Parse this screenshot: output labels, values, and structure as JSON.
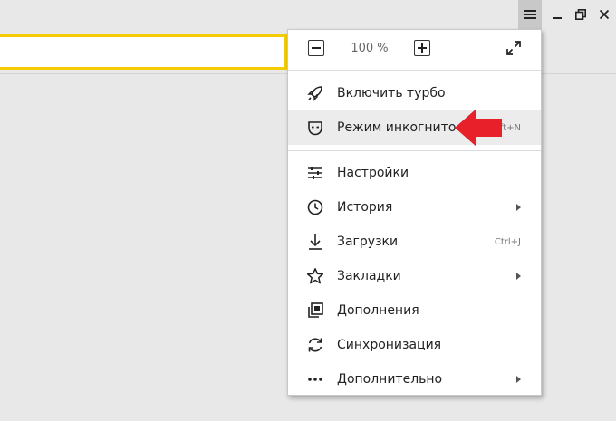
{
  "zoom": {
    "value": "100 %"
  },
  "menu": {
    "items": [
      {
        "label": "Включить турбо",
        "icon": "rocket-icon"
      },
      {
        "label": "Режим инкогнито",
        "icon": "incognito-mask-icon",
        "shortcut": "Ctrl+Shift+N",
        "shortcut_visible": "ft+N"
      },
      {
        "label": "Настройки",
        "icon": "settings-sliders-icon"
      },
      {
        "label": "История",
        "icon": "clock-icon",
        "has_submenu": true
      },
      {
        "label": "Загрузки",
        "icon": "download-icon",
        "shortcut": "Ctrl+J"
      },
      {
        "label": "Закладки",
        "icon": "star-icon",
        "has_submenu": true
      },
      {
        "label": "Дополнения",
        "icon": "addons-icon"
      },
      {
        "label": "Синхронизация",
        "icon": "sync-icon"
      },
      {
        "label": "Дополнительно",
        "icon": "more-dots-icon",
        "has_submenu": true
      }
    ]
  },
  "colors": {
    "accent_yellow": "#f4cc00",
    "arrow_red": "#e8202a"
  }
}
